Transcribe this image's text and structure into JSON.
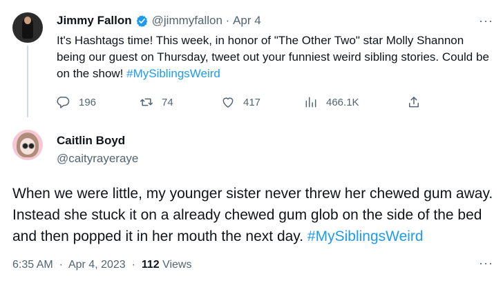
{
  "tweet1": {
    "author_name": "Jimmy Fallon",
    "handle": "@jimmyfallon",
    "date": "Apr 4",
    "separator": "·",
    "text_before_hashtag": "It's Hashtags time! This week, in honor of \"The Other Two\" star Molly Shannon being our guest on Thursday, tweet out your funniest weird sibling stories. Could be on the show! ",
    "hashtag": "#MySiblingsWeird",
    "more": "···",
    "stats": {
      "replies": "196",
      "retweets": "74",
      "likes": "417",
      "views": "466.1K"
    }
  },
  "tweet2": {
    "author_name": "Caitlin Boyd",
    "handle": "@caityrayeraye",
    "more": "···",
    "text_before_hashtag": "When we were little, my younger sister never threw her chewed gum away. Instead she stuck it on a already chewed gum glob on the side of the bed and then popped it in her mouth the next day. ",
    "hashtag": "#MySiblingsWeird",
    "time": "6:35 AM",
    "date": "Apr 4, 2023",
    "separator": "·",
    "views_count": "112",
    "views_label": "Views"
  },
  "colors": {
    "accent": "#1d9bf0",
    "text": "#0f1419",
    "muted": "#536471",
    "thread_line": "#cfd9de"
  },
  "icons": {
    "verified": "verified-badge-icon",
    "reply": "reply-icon",
    "retweet": "retweet-icon",
    "like": "heart-icon",
    "views": "views-chart-icon",
    "share": "share-icon",
    "more": "more-dots-icon"
  }
}
